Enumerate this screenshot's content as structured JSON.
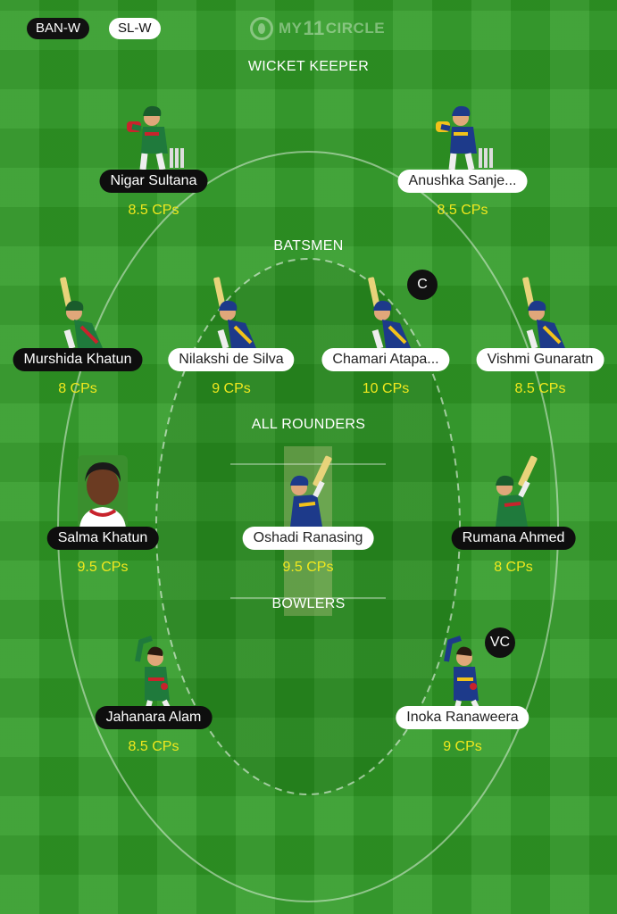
{
  "header": {
    "team_a": "BAN-W",
    "team_b": "SL-W",
    "logo_text_prefix": "MY",
    "logo_text_number": "11",
    "logo_text_suffix": "CIRCLE"
  },
  "colors": {
    "field": "#2f9a25",
    "credits": "#f0e81e",
    "ban_jersey": "#1f7a3c",
    "ban_accent": "#c8232c",
    "sl_jersey": "#1d3a8a",
    "sl_accent": "#f2c21a"
  },
  "sections": {
    "wicket_keeper": "WICKET KEEPER",
    "batsmen": "BATSMEN",
    "all_rounders": "ALL ROUNDERS",
    "bowlers": "BOWLERS"
  },
  "players": {
    "wk1": {
      "name": "Nigar Sultana",
      "credits": "8.5 CPs",
      "team": "BAN-W",
      "role_icon": "wicketkeeper-icon"
    },
    "wk2": {
      "name": "Anushka Sanje...",
      "credits": "8.5 CPs",
      "team": "SL-W",
      "role_icon": "wicketkeeper-icon"
    },
    "bat1": {
      "name": "Murshida Khatun",
      "credits": "8 CPs",
      "team": "BAN-W",
      "role_icon": "batsman-icon"
    },
    "bat2": {
      "name": "Nilakshi de Silva",
      "credits": "9 CPs",
      "team": "SL-W",
      "role_icon": "batsman-icon"
    },
    "bat3": {
      "name": "Chamari Atapa...",
      "credits": "10 CPs",
      "team": "SL-W",
      "role_icon": "batsman-icon",
      "badge": "C"
    },
    "bat4": {
      "name": "Vishmi Gunaratn",
      "credits": "8.5 CPs",
      "team": "SL-W",
      "role_icon": "batsman-icon"
    },
    "ar1": {
      "name": "Salma Khatun",
      "credits": "9.5 CPs",
      "team": "BAN-W",
      "role_icon": "player-photo"
    },
    "ar2": {
      "name": "Oshadi Ranasing",
      "credits": "9.5 CPs",
      "team": "SL-W",
      "role_icon": "allrounder-icon"
    },
    "ar3": {
      "name": "Rumana Ahmed",
      "credits": "8 CPs",
      "team": "BAN-W",
      "role_icon": "allrounder-icon"
    },
    "bowl1": {
      "name": "Jahanara Alam",
      "credits": "8.5 CPs",
      "team": "BAN-W",
      "role_icon": "bowler-icon"
    },
    "bowl2": {
      "name": "Inoka Ranaweera",
      "credits": "9 CPs",
      "team": "SL-W",
      "role_icon": "bowler-icon",
      "badge": "VC"
    }
  }
}
